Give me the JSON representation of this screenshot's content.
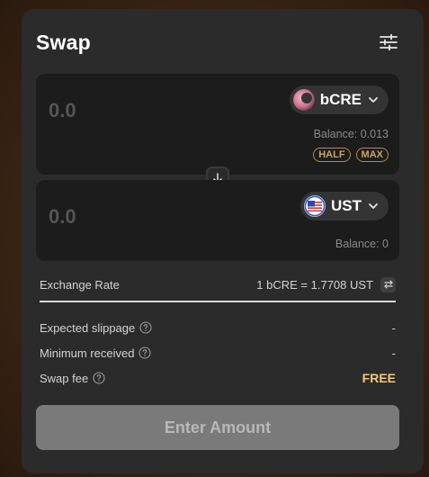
{
  "header": {
    "title": "Swap",
    "settings_icon": "sliders-icon"
  },
  "from": {
    "amount_placeholder": "0.0",
    "token": "bCRE",
    "balance": "Balance: 0.013",
    "half_label": "HALF",
    "max_label": "MAX"
  },
  "to": {
    "amount_placeholder": "0.0",
    "token": "UST",
    "balance": "Balance: 0"
  },
  "rate": {
    "label": "Exchange Rate",
    "value": "1 bCRE = 1.7708 UST"
  },
  "details": [
    {
      "label": "Expected slippage",
      "value": "-"
    },
    {
      "label": "Minimum received",
      "value": "-"
    },
    {
      "label": "Swap fee",
      "value": "FREE"
    }
  ],
  "cta": {
    "label": "Enter Amount"
  },
  "colors": {
    "card": "#2b2b2b",
    "panel": "#1c1c1c",
    "accent": "#f3c77b",
    "pill": "#c9a56a",
    "cta_bg": "#7a7a7a"
  }
}
